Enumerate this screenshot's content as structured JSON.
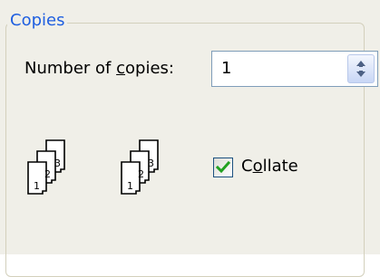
{
  "group": {
    "title": "Copies"
  },
  "copies": {
    "label_before": "Number of ",
    "label_accel": "c",
    "label_after": "opies:",
    "value": "1"
  },
  "collate": {
    "label_before": "C",
    "label_accel": "o",
    "label_after": "llate",
    "checked": true,
    "icons": {
      "left": [
        "1",
        "2",
        "3"
      ],
      "right": [
        "1",
        "2",
        "3"
      ]
    }
  },
  "icons": {
    "spin": "up-down-arrows-icon",
    "check": "checkmark-icon",
    "collate_left": "collated-pages-icon",
    "collate_right": "collated-pages-icon"
  },
  "colors": {
    "title": "#1f5fe0",
    "check": "#21a121",
    "panel": "#f0efe8"
  }
}
